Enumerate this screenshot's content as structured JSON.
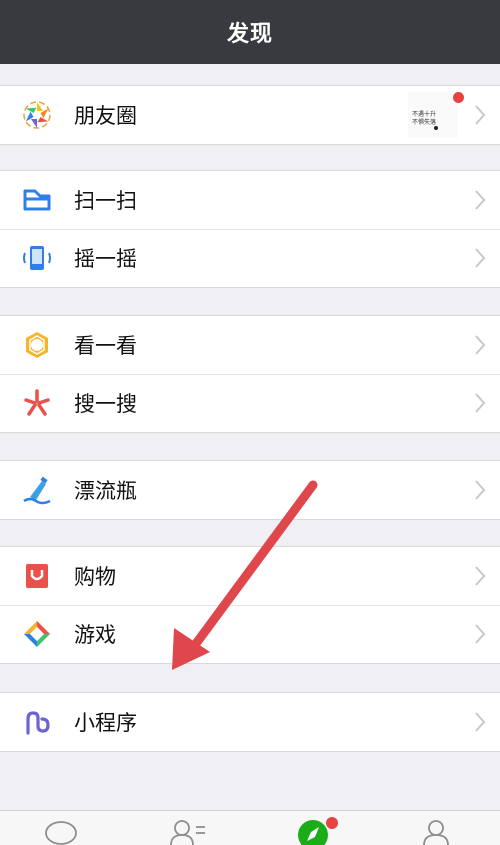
{
  "navbar": {
    "title": "发现"
  },
  "groups": [
    {
      "items": [
        {
          "label": "朋友圈",
          "icon": "moments-icon"
        }
      ]
    },
    {
      "items": [
        {
          "label": "扫一扫",
          "icon": "scan-icon"
        },
        {
          "label": "摇一摇",
          "icon": "shake-icon"
        }
      ]
    },
    {
      "items": [
        {
          "label": "看一看",
          "icon": "top-stories-icon"
        },
        {
          "label": "搜一搜",
          "icon": "search-icon"
        }
      ]
    },
    {
      "items": [
        {
          "label": "漂流瓶",
          "icon": "drift-bottle-icon"
        }
      ]
    },
    {
      "items": [
        {
          "label": "购物",
          "icon": "shopping-icon"
        },
        {
          "label": "游戏",
          "icon": "games-icon"
        }
      ]
    },
    {
      "items": [
        {
          "label": "小程序",
          "icon": "mini-program-icon"
        }
      ]
    }
  ],
  "moments_preview": {
    "line1": "不遇十升",
    "line2": "不惧失落"
  },
  "tabbar": {
    "tabs": [
      {
        "icon": "chats-icon"
      },
      {
        "icon": "contacts-icon"
      },
      {
        "icon": "discover-icon",
        "active": true,
        "badge": true
      },
      {
        "icon": "me-icon"
      }
    ]
  },
  "colors": {
    "navbar_bg": "#393a3f",
    "page_bg": "#efeff4",
    "badge_red": "#e64340",
    "active_green": "#1aad19",
    "annotation_arrow": "#e0474c"
  }
}
